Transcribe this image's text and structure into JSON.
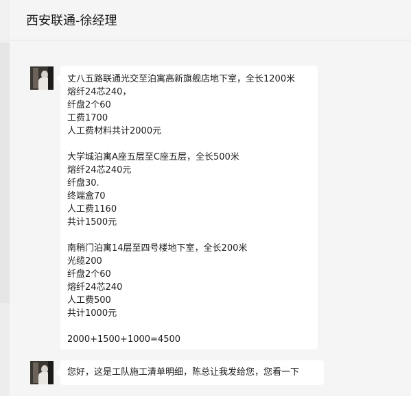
{
  "header": {
    "title": "西安联通-徐经理"
  },
  "messages": [
    {
      "blocks": [
        [
          "丈八五路联通光交至泊寓高新旗舰店地下室，全长1200米",
          "熔纤24芯240，",
          "纤盘2个60",
          "工费1700",
          "人工费材料共计2000元"
        ],
        [
          "大学城泊寓A座五层至C座五层，全长500米",
          "熔纤24芯240元",
          "纤盘30.",
          "终端盒70",
          "人工费1160",
          "共计1500元"
        ],
        [
          "南稍门泊寓14层至四号楼地下室，全长200米",
          "光缆200",
          "纤盘2个60",
          "熔纤24芯240",
          "人工费500",
          "共计1000元"
        ],
        [
          "2000+1500+1000=4500"
        ]
      ]
    },
    {
      "text": "您好，这是工队施工清单明细，陈总让我发给您，您看一下"
    }
  ]
}
